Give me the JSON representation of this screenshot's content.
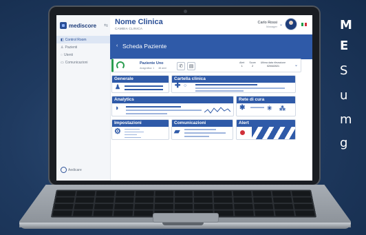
{
  "sidebar": {
    "logo": "mediscore",
    "items": [
      {
        "label": "Control Room",
        "active": true
      },
      {
        "label": "Pazienti",
        "active": false
      },
      {
        "label": "Utenti",
        "active": false
      },
      {
        "label": "Comunicazioni",
        "active": false
      }
    ],
    "footer_brand": "Aedicare"
  },
  "header": {
    "title": "Nome Clinica",
    "subtitle": "CAMBIA CLINICA",
    "user_name": "Carlo Rossi",
    "user_role": "Manager",
    "language_flag": "IT"
  },
  "banner": {
    "title": "Scheda Paziente"
  },
  "patient": {
    "name": "Paziente Uno",
    "meta": [
      "Anagrafica: 1",
      "48 anni"
    ],
    "stats": [
      {
        "label": "Alert",
        "value": "1"
      },
      {
        "label": "Score",
        "value": "2"
      },
      {
        "label": "Ultima data rilevazione",
        "value": "02/04/2021"
      }
    ]
  },
  "tiles": {
    "generale": "Generale",
    "cartella": "Cartella clinica",
    "analytics": "Analytics",
    "rete": "Rete di cura",
    "impostazioni": "Impostazioni",
    "comunicazioni": "Comunicazioni",
    "alert": "Alert"
  },
  "side_text": [
    "M",
    "E",
    "S",
    "u",
    "m",
    "g"
  ],
  "colors": {
    "primary": "#2f5aa8",
    "accent_green": "#2a9d4f",
    "alert_red": "#d0303a"
  }
}
